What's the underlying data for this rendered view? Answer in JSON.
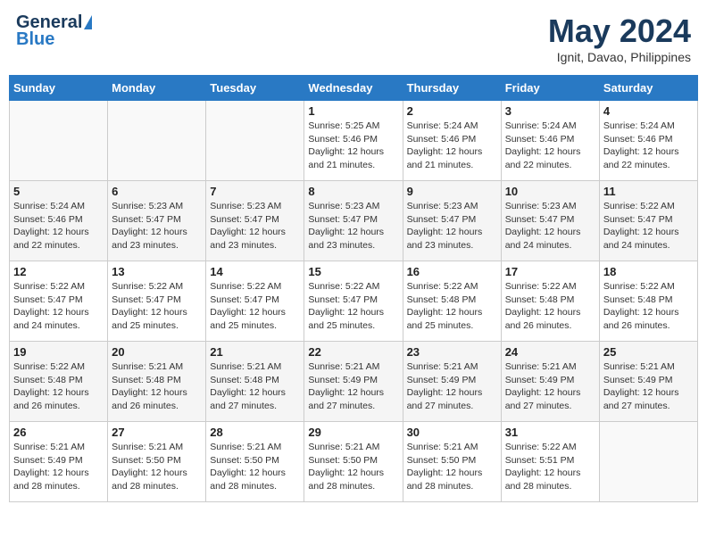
{
  "header": {
    "logo_general": "General",
    "logo_blue": "Blue",
    "month": "May 2024",
    "location": "Ignit, Davao, Philippines"
  },
  "weekdays": [
    "Sunday",
    "Monday",
    "Tuesday",
    "Wednesday",
    "Thursday",
    "Friday",
    "Saturday"
  ],
  "weeks": [
    [
      {
        "day": "",
        "info": ""
      },
      {
        "day": "",
        "info": ""
      },
      {
        "day": "",
        "info": ""
      },
      {
        "day": "1",
        "info": "Sunrise: 5:25 AM\nSunset: 5:46 PM\nDaylight: 12 hours and 21 minutes."
      },
      {
        "day": "2",
        "info": "Sunrise: 5:24 AM\nSunset: 5:46 PM\nDaylight: 12 hours and 21 minutes."
      },
      {
        "day": "3",
        "info": "Sunrise: 5:24 AM\nSunset: 5:46 PM\nDaylight: 12 hours and 22 minutes."
      },
      {
        "day": "4",
        "info": "Sunrise: 5:24 AM\nSunset: 5:46 PM\nDaylight: 12 hours and 22 minutes."
      }
    ],
    [
      {
        "day": "5",
        "info": "Sunrise: 5:24 AM\nSunset: 5:46 PM\nDaylight: 12 hours and 22 minutes."
      },
      {
        "day": "6",
        "info": "Sunrise: 5:23 AM\nSunset: 5:47 PM\nDaylight: 12 hours and 23 minutes."
      },
      {
        "day": "7",
        "info": "Sunrise: 5:23 AM\nSunset: 5:47 PM\nDaylight: 12 hours and 23 minutes."
      },
      {
        "day": "8",
        "info": "Sunrise: 5:23 AM\nSunset: 5:47 PM\nDaylight: 12 hours and 23 minutes."
      },
      {
        "day": "9",
        "info": "Sunrise: 5:23 AM\nSunset: 5:47 PM\nDaylight: 12 hours and 23 minutes."
      },
      {
        "day": "10",
        "info": "Sunrise: 5:23 AM\nSunset: 5:47 PM\nDaylight: 12 hours and 24 minutes."
      },
      {
        "day": "11",
        "info": "Sunrise: 5:22 AM\nSunset: 5:47 PM\nDaylight: 12 hours and 24 minutes."
      }
    ],
    [
      {
        "day": "12",
        "info": "Sunrise: 5:22 AM\nSunset: 5:47 PM\nDaylight: 12 hours and 24 minutes."
      },
      {
        "day": "13",
        "info": "Sunrise: 5:22 AM\nSunset: 5:47 PM\nDaylight: 12 hours and 25 minutes."
      },
      {
        "day": "14",
        "info": "Sunrise: 5:22 AM\nSunset: 5:47 PM\nDaylight: 12 hours and 25 minutes."
      },
      {
        "day": "15",
        "info": "Sunrise: 5:22 AM\nSunset: 5:47 PM\nDaylight: 12 hours and 25 minutes."
      },
      {
        "day": "16",
        "info": "Sunrise: 5:22 AM\nSunset: 5:48 PM\nDaylight: 12 hours and 25 minutes."
      },
      {
        "day": "17",
        "info": "Sunrise: 5:22 AM\nSunset: 5:48 PM\nDaylight: 12 hours and 26 minutes."
      },
      {
        "day": "18",
        "info": "Sunrise: 5:22 AM\nSunset: 5:48 PM\nDaylight: 12 hours and 26 minutes."
      }
    ],
    [
      {
        "day": "19",
        "info": "Sunrise: 5:22 AM\nSunset: 5:48 PM\nDaylight: 12 hours and 26 minutes."
      },
      {
        "day": "20",
        "info": "Sunrise: 5:21 AM\nSunset: 5:48 PM\nDaylight: 12 hours and 26 minutes."
      },
      {
        "day": "21",
        "info": "Sunrise: 5:21 AM\nSunset: 5:48 PM\nDaylight: 12 hours and 27 minutes."
      },
      {
        "day": "22",
        "info": "Sunrise: 5:21 AM\nSunset: 5:49 PM\nDaylight: 12 hours and 27 minutes."
      },
      {
        "day": "23",
        "info": "Sunrise: 5:21 AM\nSunset: 5:49 PM\nDaylight: 12 hours and 27 minutes."
      },
      {
        "day": "24",
        "info": "Sunrise: 5:21 AM\nSunset: 5:49 PM\nDaylight: 12 hours and 27 minutes."
      },
      {
        "day": "25",
        "info": "Sunrise: 5:21 AM\nSunset: 5:49 PM\nDaylight: 12 hours and 27 minutes."
      }
    ],
    [
      {
        "day": "26",
        "info": "Sunrise: 5:21 AM\nSunset: 5:49 PM\nDaylight: 12 hours and 28 minutes."
      },
      {
        "day": "27",
        "info": "Sunrise: 5:21 AM\nSunset: 5:50 PM\nDaylight: 12 hours and 28 minutes."
      },
      {
        "day": "28",
        "info": "Sunrise: 5:21 AM\nSunset: 5:50 PM\nDaylight: 12 hours and 28 minutes."
      },
      {
        "day": "29",
        "info": "Sunrise: 5:21 AM\nSunset: 5:50 PM\nDaylight: 12 hours and 28 minutes."
      },
      {
        "day": "30",
        "info": "Sunrise: 5:21 AM\nSunset: 5:50 PM\nDaylight: 12 hours and 28 minutes."
      },
      {
        "day": "31",
        "info": "Sunrise: 5:22 AM\nSunset: 5:51 PM\nDaylight: 12 hours and 28 minutes."
      },
      {
        "day": "",
        "info": ""
      }
    ]
  ]
}
